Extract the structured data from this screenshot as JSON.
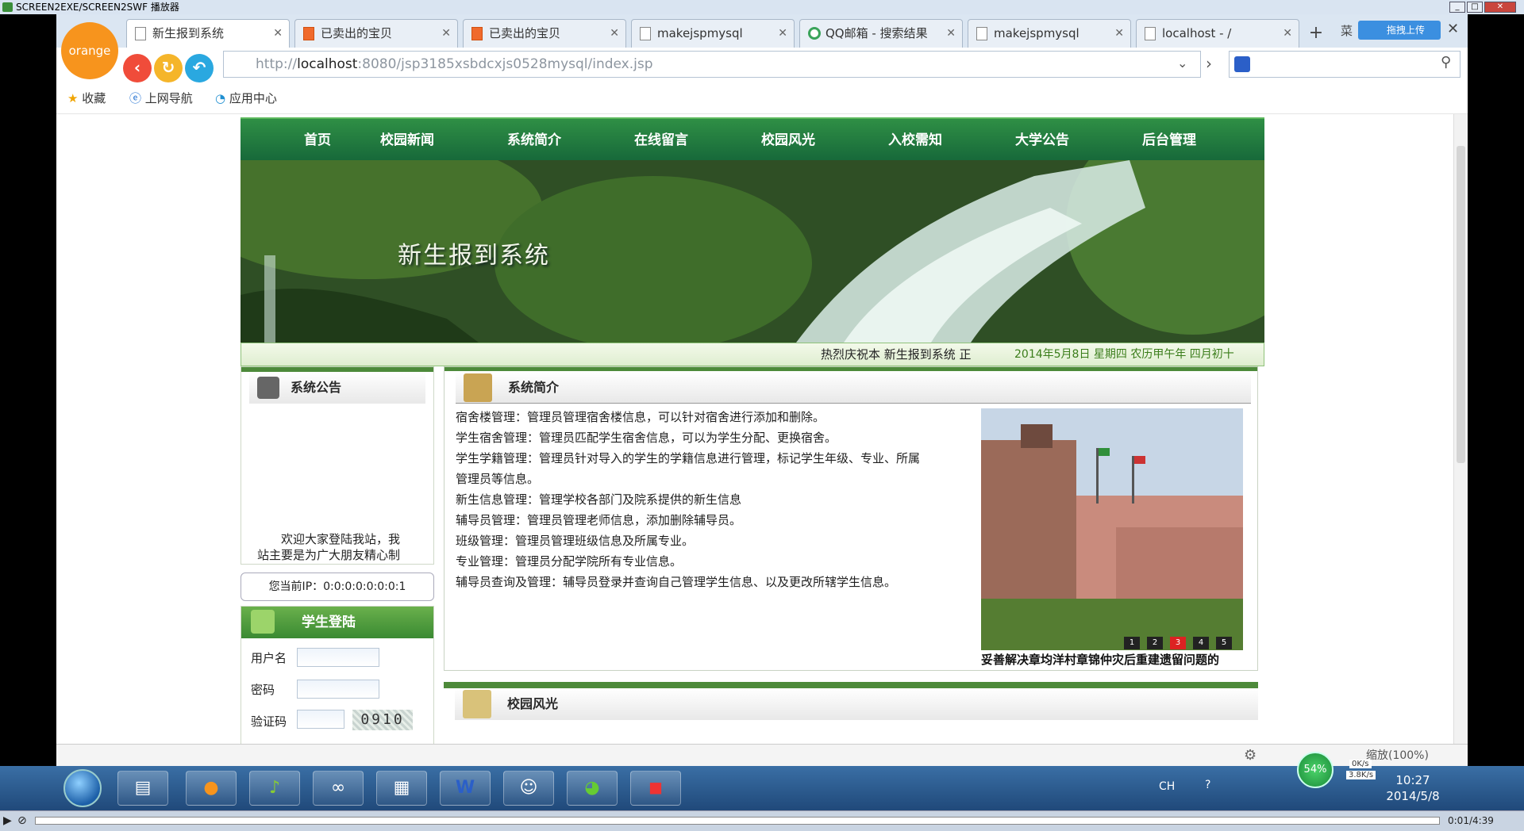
{
  "player": {
    "title": "SCREEN2EXE/SCREEN2SWF 播放器",
    "time": "0:01/4:39"
  },
  "browser": {
    "brand": "orange",
    "tabs": [
      {
        "label": "新生报到系统",
        "active": true,
        "icon": "page-icon"
      },
      {
        "label": "已卖出的宝贝",
        "active": false,
        "icon": "taobao-icon"
      },
      {
        "label": "已卖出的宝贝",
        "active": false,
        "icon": "taobao-icon"
      },
      {
        "label": "makejspmysql",
        "active": false,
        "icon": "page-icon"
      },
      {
        "label": "QQ邮箱 - 搜索结果",
        "active": false,
        "icon": "qq-icon"
      },
      {
        "label": "makejspmysql",
        "active": false,
        "icon": "page-icon"
      },
      {
        "label": "localhost - /",
        "active": false,
        "icon": "page-icon"
      }
    ],
    "new_tab": "+",
    "extra_tab_label": "菜",
    "upload_label": "拖拽上传",
    "url_prefix": "http://",
    "url_host": "localhost",
    "url_rest": ":8080/jsp3185xsbdcxjs0528mysql/index.jsp",
    "bookmarks": {
      "fav": "收藏",
      "nav": "上网导航",
      "apps": "应用中心"
    },
    "zoom": "缩放(100%)"
  },
  "site": {
    "nav": [
      "首页",
      "校园新闻",
      "系统简介",
      "在线留言",
      "校园风光",
      "入校需知",
      "大学公告",
      "后台管理"
    ],
    "banner_title": "新生报到系统",
    "marquee": "热烈庆祝本 新生报到系统 正",
    "date": "2014年5月8日 星期四 农历甲午年 四月初十",
    "notice": {
      "title": "系统公告",
      "text_line1": "欢迎大家登陆我站，我",
      "text_line2": "站主要是为广大朋友精心制"
    },
    "ip_label": "您当前IP：0:0:0:0:0:0:0:1",
    "login": {
      "title": "学生登陆",
      "username": "用户名",
      "password": "密码",
      "captcha": "验证码",
      "captcha_code": "0910"
    },
    "intro": {
      "title": "系统简介",
      "lines": [
        "宿舍楼管理：管理员管理宿舍楼信息，可以针对宿舍进行添加和删除。",
        "学生宿舍管理：管理员匹配学生宿舍信息，可以为学生分配、更换宿舍。",
        "学生学籍管理：管理员针对导入的学生的学籍信息进行管理，标记学生年级、专业、所属",
        "管理员等信息。",
        "新生信息管理：管理学校各部门及院系提供的新生信息",
        "辅导员管理：管理员管理老师信息，添加删除辅导员。",
        "班级管理：管理员管理班级信息及所属专业。",
        "专业管理：管理员分配学院所有专业信息。",
        "辅导员查询及管理：辅导员登录并查询自己管理学生信息、以及更改所辖学生信息。"
      ],
      "photo_caption": "妥善解决章均洋村章锦仲灾后重建遗留问题的",
      "pages": [
        "1",
        "2",
        "3",
        "4",
        "5"
      ],
      "active_page": "3"
    },
    "gallery": {
      "title": "校园风光"
    }
  },
  "taskbar": {
    "apps": [
      "file-explorer",
      "orange-browser",
      "itunes-like",
      "media-app",
      "archive-tool",
      "word",
      "photo-app",
      "green-app",
      "red-app"
    ],
    "lang": "CH",
    "battery": "54%",
    "net_up": "0K/s",
    "net_down": "3.8K/s",
    "time": "10:27",
    "date": "2014/5/8"
  }
}
